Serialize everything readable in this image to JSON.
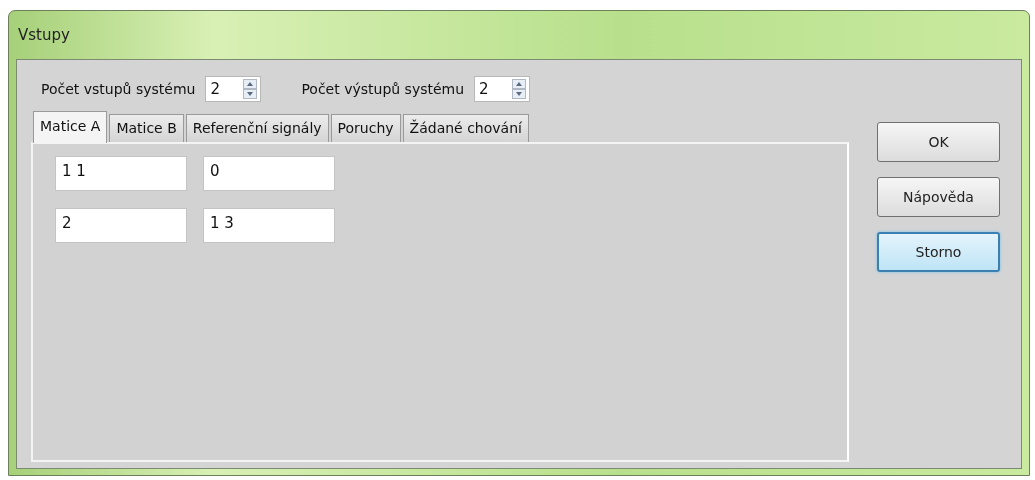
{
  "window": {
    "title": "Vstupy"
  },
  "spinners": [
    {
      "label": "Počet vstupů systému",
      "value": "2"
    },
    {
      "label": "Počet výstupů systému",
      "value": "2"
    }
  ],
  "tabs": [
    {
      "label": "Matice A",
      "selected": true
    },
    {
      "label": "Matice B",
      "selected": false
    },
    {
      "label": "Referenční signály",
      "selected": false
    },
    {
      "label": "Poruchy",
      "selected": false
    },
    {
      "label": "Žádané chování",
      "selected": false
    }
  ],
  "matrix": [
    [
      "1 1",
      "0"
    ],
    [
      "2",
      "1 3"
    ]
  ],
  "buttons": [
    {
      "label": "OK",
      "focused": false
    },
    {
      "label": "Nápověda",
      "focused": false
    },
    {
      "label": "Storno",
      "focused": true
    }
  ]
}
